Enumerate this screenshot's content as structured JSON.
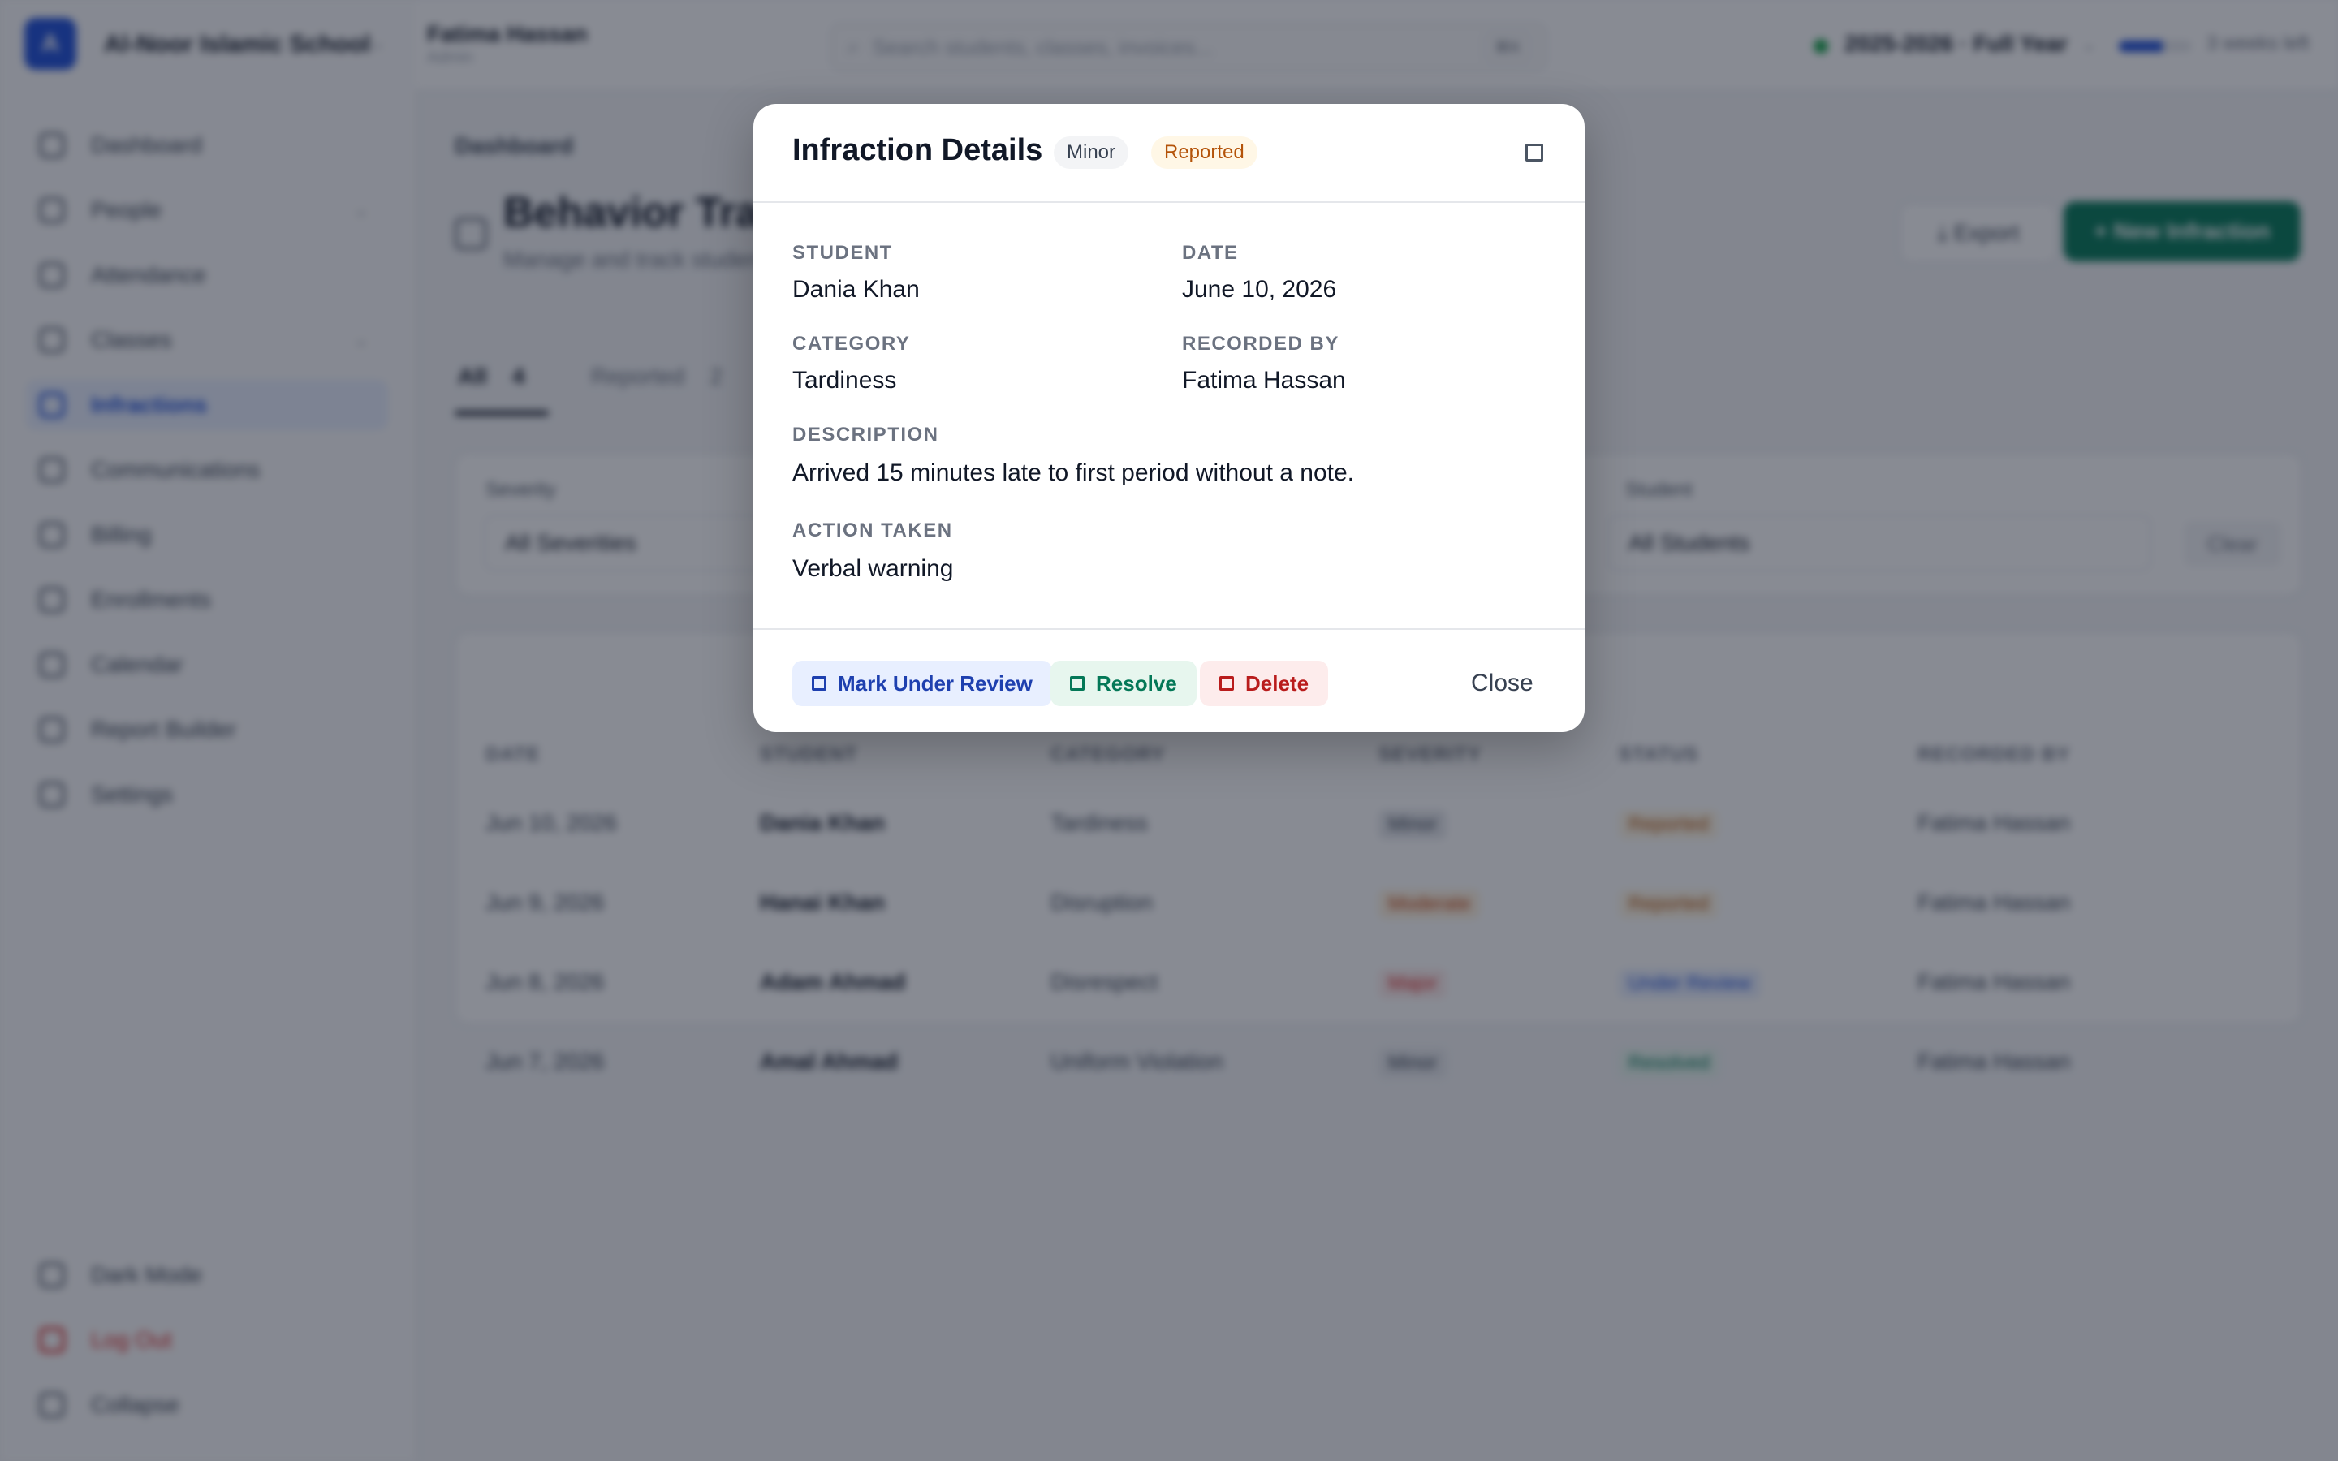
{
  "sidebar": {
    "logo_letter": "A",
    "school_name": "Al-Noor Islamic School",
    "items": [
      {
        "label": "Dashboard",
        "icon": "home-icon"
      },
      {
        "label": "People",
        "icon": "people-icon"
      },
      {
        "label": "Attendance",
        "icon": "clipboard-icon"
      },
      {
        "label": "Classes",
        "icon": "book-icon"
      },
      {
        "label": "Infractions",
        "icon": "flag-icon"
      },
      {
        "label": "Communications",
        "icon": "message-icon"
      },
      {
        "label": "Billing",
        "icon": "dollar-icon"
      },
      {
        "label": "Enrollments",
        "icon": "user-plus-icon"
      },
      {
        "label": "Calendar",
        "icon": "calendar-icon"
      },
      {
        "label": "Report Builder",
        "icon": "file-icon"
      },
      {
        "label": "Settings",
        "icon": "gear-icon"
      }
    ],
    "bottom": {
      "dark_mode": "Dark Mode",
      "logout": "Log Out",
      "collapse": "Collapse"
    }
  },
  "topbar": {
    "user_name": "Fatima Hassan",
    "user_role": "Admin",
    "search_placeholder": "Search students, classes, invoices...",
    "search_shortcut": "⌘K",
    "school_year": "2025-2026 · Full Year",
    "progress_fraction": 0.6,
    "progress_text": "3 weeks left"
  },
  "main": {
    "breadcrumb": "Dashboard",
    "title": "Behavior Tracking",
    "subtitle": "Manage and track student behavior infractions",
    "export_label": "Export",
    "new_label": "+ New Infraction",
    "tabs": [
      {
        "label": "All",
        "count": "4"
      },
      {
        "label": "Reported",
        "count": "2"
      }
    ],
    "filters": {
      "severity_label": "Severity",
      "severity_value": "All Severities",
      "student_label": "Student",
      "student_value": "All Students",
      "clear_label": "Clear"
    },
    "columns": [
      "DATE",
      "STUDENT",
      "CATEGORY",
      "SEVERITY",
      "STATUS",
      "RECORDED BY"
    ],
    "rows": [
      {
        "date": "Jun 10, 2026",
        "student": "Dania Khan",
        "category": "Tardiness",
        "severity": "Minor",
        "status": "Reported",
        "recorded_by": "Fatima Hassan"
      },
      {
        "date": "Jun 9, 2026",
        "student": "Hanai Khan",
        "category": "Disruption",
        "severity": "Moderate",
        "status": "Reported",
        "recorded_by": "Fatima Hassan"
      },
      {
        "date": "Jun 8, 2026",
        "student": "Adam Ahmad",
        "category": "Disrespect",
        "severity": "Major",
        "status": "Under Review",
        "recorded_by": "Fatima Hassan"
      },
      {
        "date": "Jun 7, 2026",
        "student": "Amal Ahmad",
        "category": "Uniform Violation",
        "severity": "Minor",
        "status": "Resolved",
        "recorded_by": "Fatima Hassan"
      }
    ]
  },
  "modal": {
    "title": "Infraction Details",
    "severity_badge": "Minor",
    "status_badge": "Reported",
    "close_icon": "close-icon",
    "fields": {
      "student_label": "STUDENT",
      "student_value": "Dania Khan",
      "date_label": "DATE",
      "date_value": "June 10, 2026",
      "category_label": "CATEGORY",
      "category_value": "Tardiness",
      "recorded_by_label": "RECORDED BY",
      "recorded_by_value": "Fatima Hassan",
      "description_label": "DESCRIPTION",
      "description_value": "Arrived 15 minutes late to first period without a note.",
      "action_label": "ACTION TAKEN",
      "action_value": "Verbal warning"
    },
    "buttons": {
      "review": "Mark Under Review",
      "resolve": "Resolve",
      "delete": "Delete",
      "close": "Close"
    }
  },
  "colors": {
    "accent": "#1d4ed8",
    "success": "#047857",
    "danger": "#b91c1c",
    "warning": "#b45309"
  }
}
